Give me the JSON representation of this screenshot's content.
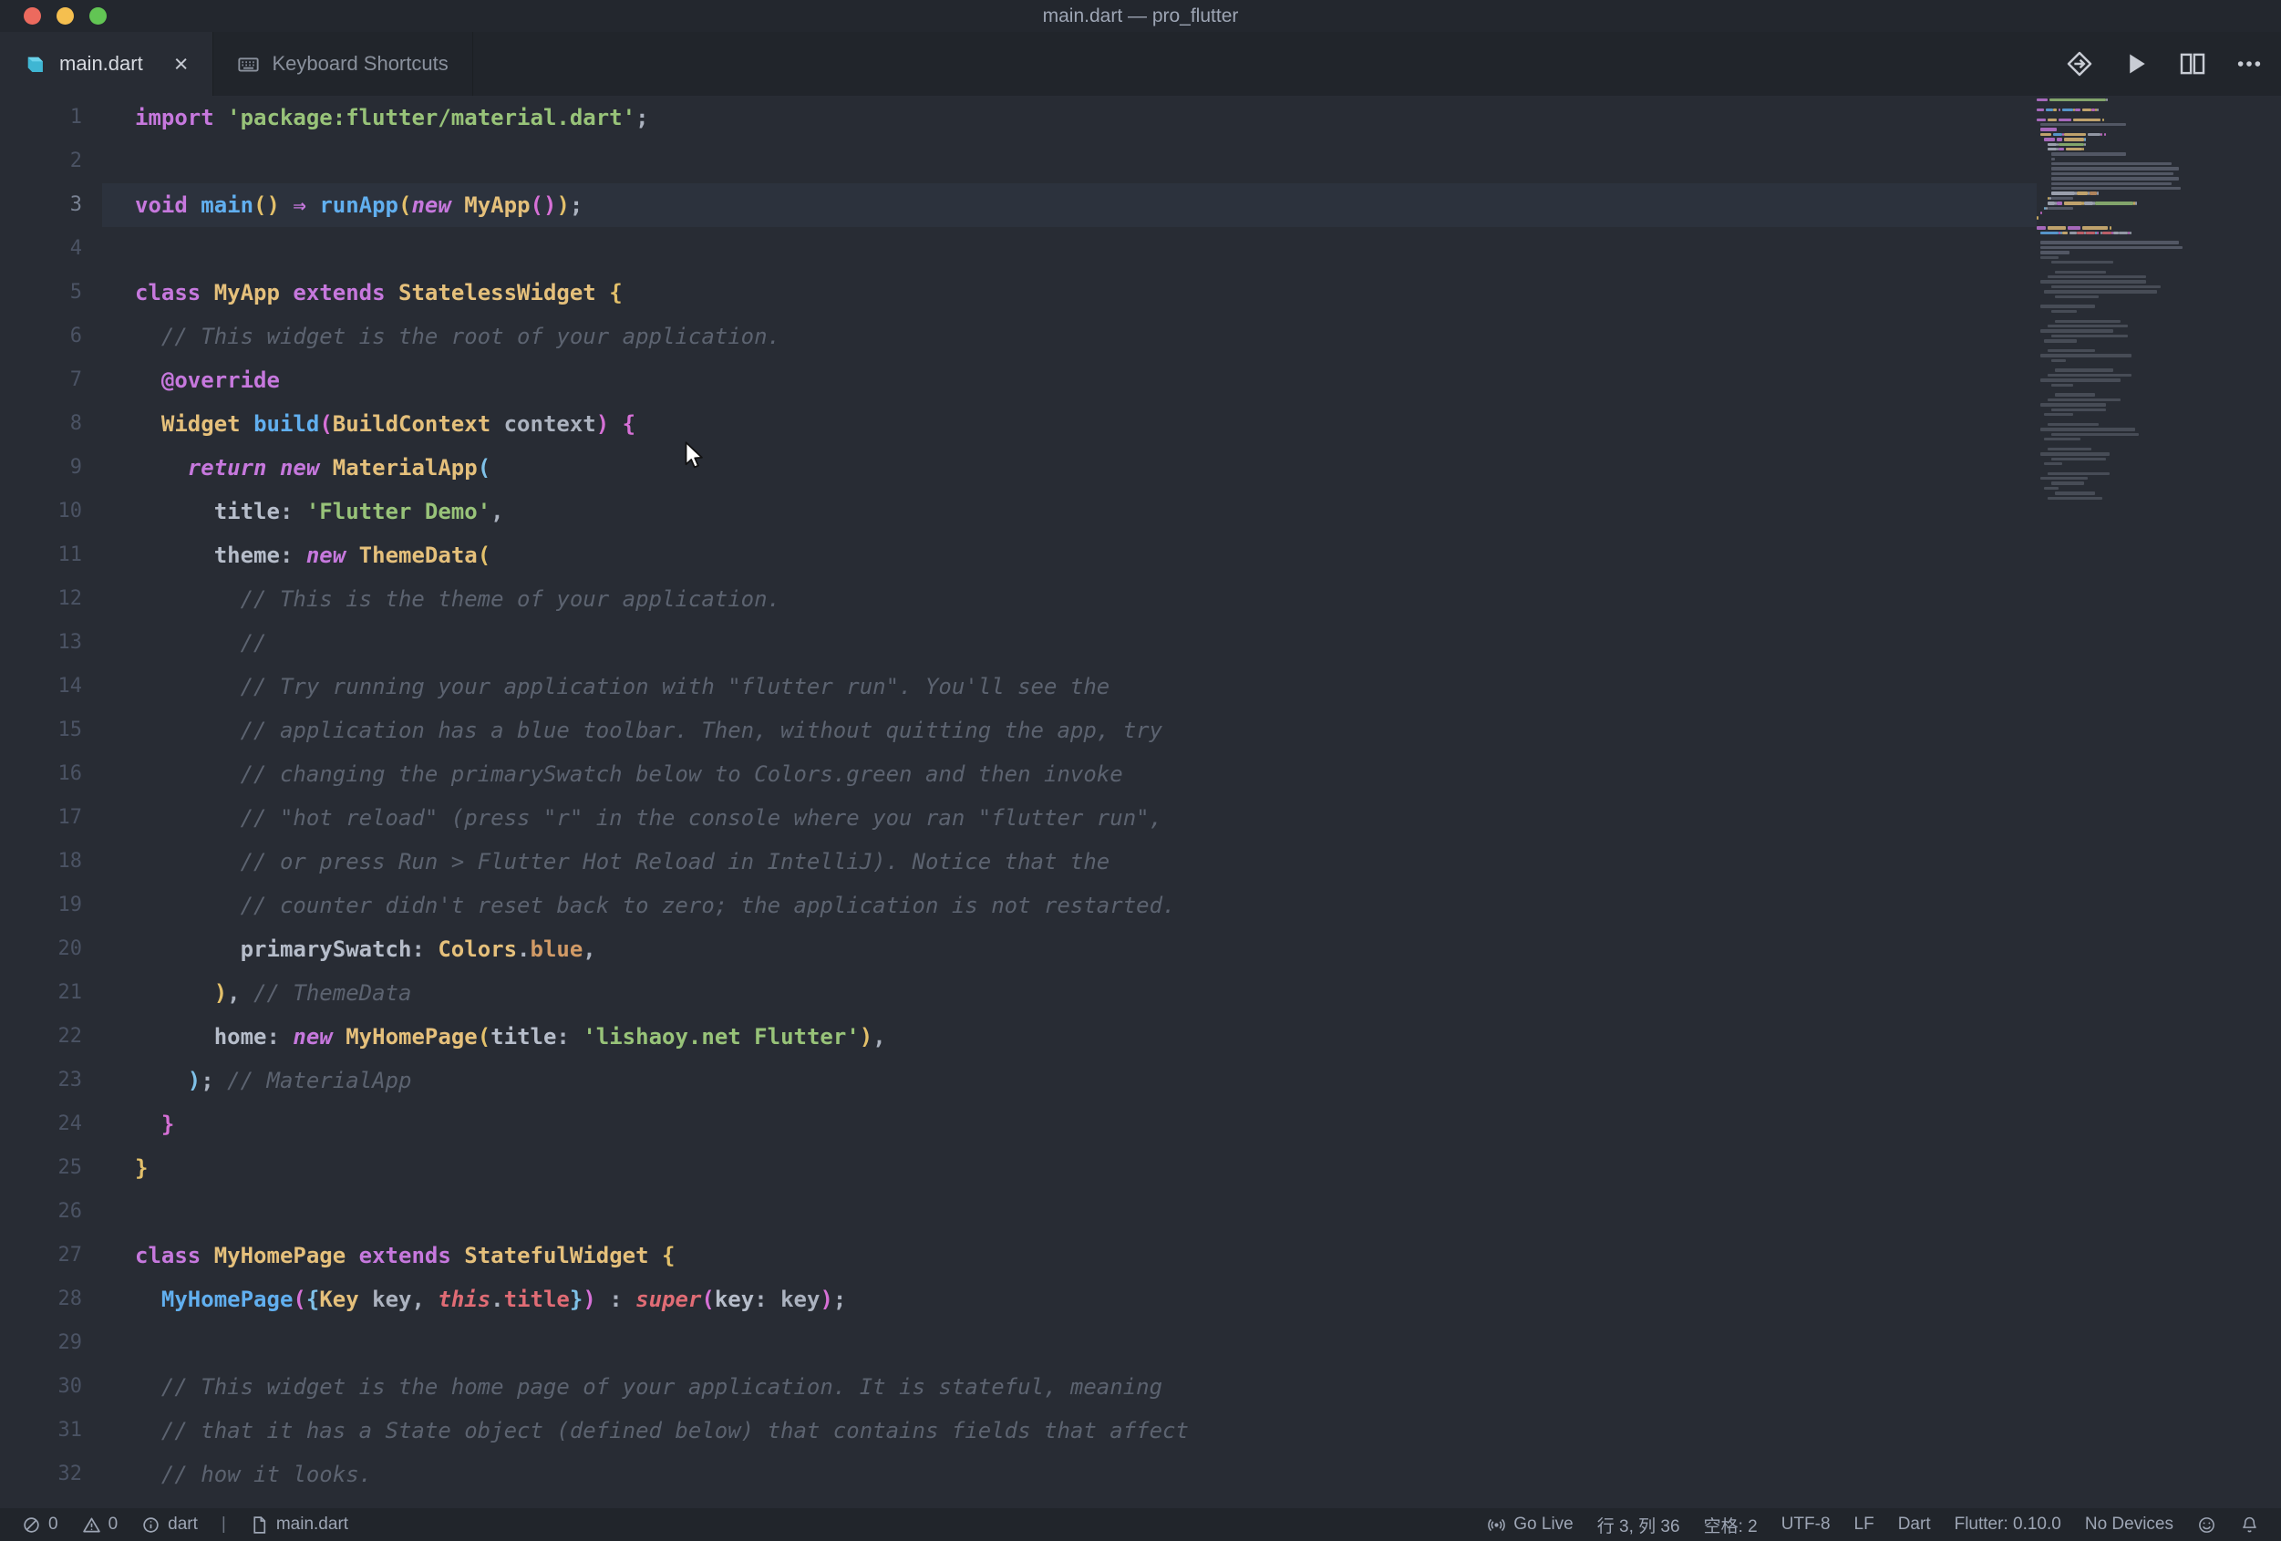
{
  "window": {
    "title": "main.dart — pro_flutter"
  },
  "tabs": [
    {
      "label": "main.dart",
      "state": "active",
      "close_glyph": "×"
    },
    {
      "label": "Keyboard Shortcuts",
      "state": "inactive"
    }
  ],
  "editor": {
    "active_line": 3,
    "lines": [
      {
        "num": 1,
        "tokens": [
          {
            "c": "kw",
            "t": "import"
          },
          {
            "c": "plain",
            "t": " "
          },
          {
            "c": "str",
            "t": "'package:flutter/material.dart'"
          },
          {
            "c": "plain",
            "t": ";"
          }
        ]
      },
      {
        "num": 2,
        "tokens": []
      },
      {
        "num": 3,
        "tokens": [
          {
            "c": "kw",
            "t": "void"
          },
          {
            "c": "plain",
            "t": " "
          },
          {
            "c": "fn",
            "t": "main"
          },
          {
            "c": "b1",
            "t": "()"
          },
          {
            "c": "plain",
            "t": " "
          },
          {
            "c": "kw",
            "t": "⇒"
          },
          {
            "c": "plain",
            "t": " "
          },
          {
            "c": "fn",
            "t": "runApp"
          },
          {
            "c": "b1",
            "t": "("
          },
          {
            "c": "kwi",
            "t": "new"
          },
          {
            "c": "plain",
            "t": " "
          },
          {
            "c": "type",
            "t": "MyApp"
          },
          {
            "c": "b2",
            "t": "()"
          },
          {
            "c": "b1",
            "t": ")"
          },
          {
            "c": "plain",
            "t": ";"
          }
        ]
      },
      {
        "num": 4,
        "tokens": []
      },
      {
        "num": 5,
        "tokens": [
          {
            "c": "kw",
            "t": "class"
          },
          {
            "c": "plain",
            "t": " "
          },
          {
            "c": "type",
            "t": "MyApp"
          },
          {
            "c": "plain",
            "t": " "
          },
          {
            "c": "kw",
            "t": "extends"
          },
          {
            "c": "plain",
            "t": " "
          },
          {
            "c": "type",
            "t": "StatelessWidget"
          },
          {
            "c": "plain",
            "t": " "
          },
          {
            "c": "b1",
            "t": "{"
          }
        ]
      },
      {
        "num": 6,
        "tokens": [
          {
            "c": "com",
            "t": "  // This widget is the root of your application."
          }
        ]
      },
      {
        "num": 7,
        "tokens": [
          {
            "c": "plain",
            "t": "  "
          },
          {
            "c": "ann",
            "t": "@override"
          }
        ]
      },
      {
        "num": 8,
        "tokens": [
          {
            "c": "plain",
            "t": "  "
          },
          {
            "c": "type",
            "t": "Widget"
          },
          {
            "c": "plain",
            "t": " "
          },
          {
            "c": "fn",
            "t": "build"
          },
          {
            "c": "b2",
            "t": "("
          },
          {
            "c": "type",
            "t": "BuildContext"
          },
          {
            "c": "plain",
            "t": " context"
          },
          {
            "c": "b2",
            "t": ")"
          },
          {
            "c": "plain",
            "t": " "
          },
          {
            "c": "b2",
            "t": "{"
          }
        ]
      },
      {
        "num": 9,
        "tokens": [
          {
            "c": "plain",
            "t": "    "
          },
          {
            "c": "kwi",
            "t": "return"
          },
          {
            "c": "plain",
            "t": " "
          },
          {
            "c": "kwi",
            "t": "new"
          },
          {
            "c": "plain",
            "t": " "
          },
          {
            "c": "type",
            "t": "MaterialApp"
          },
          {
            "c": "b3",
            "t": "("
          }
        ]
      },
      {
        "num": 10,
        "tokens": [
          {
            "c": "plain",
            "t": "      "
          },
          {
            "c": "param",
            "t": "title"
          },
          {
            "c": "plain",
            "t": ": "
          },
          {
            "c": "str",
            "t": "'Flutter Demo'"
          },
          {
            "c": "plain",
            "t": ","
          }
        ]
      },
      {
        "num": 11,
        "tokens": [
          {
            "c": "plain",
            "t": "      "
          },
          {
            "c": "param",
            "t": "theme"
          },
          {
            "c": "plain",
            "t": ": "
          },
          {
            "c": "kwi",
            "t": "new"
          },
          {
            "c": "plain",
            "t": " "
          },
          {
            "c": "type",
            "t": "ThemeData"
          },
          {
            "c": "b1",
            "t": "("
          }
        ]
      },
      {
        "num": 12,
        "tokens": [
          {
            "c": "com",
            "t": "        // This is the theme of your application."
          }
        ]
      },
      {
        "num": 13,
        "tokens": [
          {
            "c": "com",
            "t": "        //"
          }
        ]
      },
      {
        "num": 14,
        "tokens": [
          {
            "c": "com",
            "t": "        // Try running your application with \"flutter run\". You'll see the"
          }
        ]
      },
      {
        "num": 15,
        "tokens": [
          {
            "c": "com",
            "t": "        // application has a blue toolbar. Then, without quitting the app, try"
          }
        ]
      },
      {
        "num": 16,
        "tokens": [
          {
            "c": "com",
            "t": "        // changing the primarySwatch below to Colors.green and then invoke"
          }
        ]
      },
      {
        "num": 17,
        "tokens": [
          {
            "c": "com",
            "t": "        // \"hot reload\" (press \"r\" in the console where you ran \"flutter run\","
          }
        ]
      },
      {
        "num": 18,
        "tokens": [
          {
            "c": "com",
            "t": "        // or press Run > Flutter Hot Reload in IntelliJ). Notice that the"
          }
        ]
      },
      {
        "num": 19,
        "tokens": [
          {
            "c": "com",
            "t": "        // counter didn't reset back to zero; the application is not restarted."
          }
        ]
      },
      {
        "num": 20,
        "tokens": [
          {
            "c": "plain",
            "t": "        "
          },
          {
            "c": "param",
            "t": "primarySwatch"
          },
          {
            "c": "plain",
            "t": ": "
          },
          {
            "c": "type",
            "t": "Colors"
          },
          {
            "c": "plain",
            "t": "."
          },
          {
            "c": "const",
            "t": "blue"
          },
          {
            "c": "plain",
            "t": ","
          }
        ]
      },
      {
        "num": 21,
        "tokens": [
          {
            "c": "plain",
            "t": "      "
          },
          {
            "c": "b1",
            "t": ")"
          },
          {
            "c": "plain",
            "t": ", "
          },
          {
            "c": "com",
            "t": "// ThemeData"
          }
        ]
      },
      {
        "num": 22,
        "tokens": [
          {
            "c": "plain",
            "t": "      "
          },
          {
            "c": "param",
            "t": "home"
          },
          {
            "c": "plain",
            "t": ": "
          },
          {
            "c": "kwi",
            "t": "new"
          },
          {
            "c": "plain",
            "t": " "
          },
          {
            "c": "type",
            "t": "MyHomePage"
          },
          {
            "c": "b1",
            "t": "("
          },
          {
            "c": "param",
            "t": "title"
          },
          {
            "c": "plain",
            "t": ": "
          },
          {
            "c": "str",
            "t": "'lishaoy.net Flutter'"
          },
          {
            "c": "b1",
            "t": ")"
          },
          {
            "c": "plain",
            "t": ","
          }
        ]
      },
      {
        "num": 23,
        "tokens": [
          {
            "c": "plain",
            "t": "    "
          },
          {
            "c": "b3",
            "t": ")"
          },
          {
            "c": "plain",
            "t": "; "
          },
          {
            "c": "com",
            "t": "// MaterialApp"
          }
        ]
      },
      {
        "num": 24,
        "tokens": [
          {
            "c": "plain",
            "t": "  "
          },
          {
            "c": "b2",
            "t": "}"
          }
        ]
      },
      {
        "num": 25,
        "tokens": [
          {
            "c": "b1",
            "t": "}"
          }
        ]
      },
      {
        "num": 26,
        "tokens": []
      },
      {
        "num": 27,
        "tokens": [
          {
            "c": "kw",
            "t": "class"
          },
          {
            "c": "plain",
            "t": " "
          },
          {
            "c": "type",
            "t": "MyHomePage"
          },
          {
            "c": "plain",
            "t": " "
          },
          {
            "c": "kw",
            "t": "extends"
          },
          {
            "c": "plain",
            "t": " "
          },
          {
            "c": "type",
            "t": "StatefulWidget"
          },
          {
            "c": "plain",
            "t": " "
          },
          {
            "c": "b1",
            "t": "{"
          }
        ]
      },
      {
        "num": 28,
        "tokens": [
          {
            "c": "plain",
            "t": "  "
          },
          {
            "c": "fn",
            "t": "MyHomePage"
          },
          {
            "c": "b2",
            "t": "("
          },
          {
            "c": "b3",
            "t": "{"
          },
          {
            "c": "type",
            "t": "Key"
          },
          {
            "c": "plain",
            "t": " key, "
          },
          {
            "c": "spec",
            "t": "this"
          },
          {
            "c": "plain",
            "t": "."
          },
          {
            "c": "prop",
            "t": "title"
          },
          {
            "c": "b3",
            "t": "}"
          },
          {
            "c": "b2",
            "t": ")"
          },
          {
            "c": "plain",
            "t": " : "
          },
          {
            "c": "spec",
            "t": "super"
          },
          {
            "c": "b2",
            "t": "("
          },
          {
            "c": "param",
            "t": "key"
          },
          {
            "c": "plain",
            "t": ": key"
          },
          {
            "c": "b2",
            "t": ")"
          },
          {
            "c": "plain",
            "t": ";"
          }
        ]
      },
      {
        "num": 29,
        "tokens": []
      },
      {
        "num": 30,
        "tokens": [
          {
            "c": "com",
            "t": "  // This widget is the home page of your application. It is stateful, meaning"
          }
        ]
      },
      {
        "num": 31,
        "tokens": [
          {
            "c": "com",
            "t": "  // that it has a State object (defined below) that contains fields that affect"
          }
        ]
      },
      {
        "num": 32,
        "tokens": [
          {
            "c": "com",
            "t": "  // how it looks."
          }
        ]
      }
    ]
  },
  "status_bar": {
    "errors": "0",
    "warnings": "0",
    "language_status": "dart",
    "separator": "|",
    "file_name": "main.dart",
    "go_live": "Go Live",
    "cursor_position": "行 3, 列 36",
    "indentation": "空格: 2",
    "encoding": "UTF-8",
    "eol": "LF",
    "language": "Dart",
    "flutter_version": "Flutter: 0.10.0",
    "devices": "No Devices"
  },
  "colors": {
    "background": "#282c34",
    "titlebar_background": "#23272e",
    "tabbar_background": "#21252b",
    "statusbar_background": "#21252b",
    "active_line_background": "#2c323d",
    "traffic_red": "#ec6a5e",
    "traffic_yellow": "#f5bf4f",
    "traffic_green": "#62c554",
    "syntax": {
      "kw": "#c678dd",
      "kwi": "#c678dd",
      "type": "#e5c07b",
      "fn": "#61afef",
      "str": "#98c379",
      "com": "#5c6370",
      "param": "#b6bdca",
      "prop": "#e06c75",
      "spec": "#e06c75",
      "ann": "#c678dd",
      "const": "#d19a66",
      "plain": "#abb2bf",
      "b1": "#e3c06a",
      "b2": "#d670d6",
      "b3": "#7fc1e8"
    }
  }
}
